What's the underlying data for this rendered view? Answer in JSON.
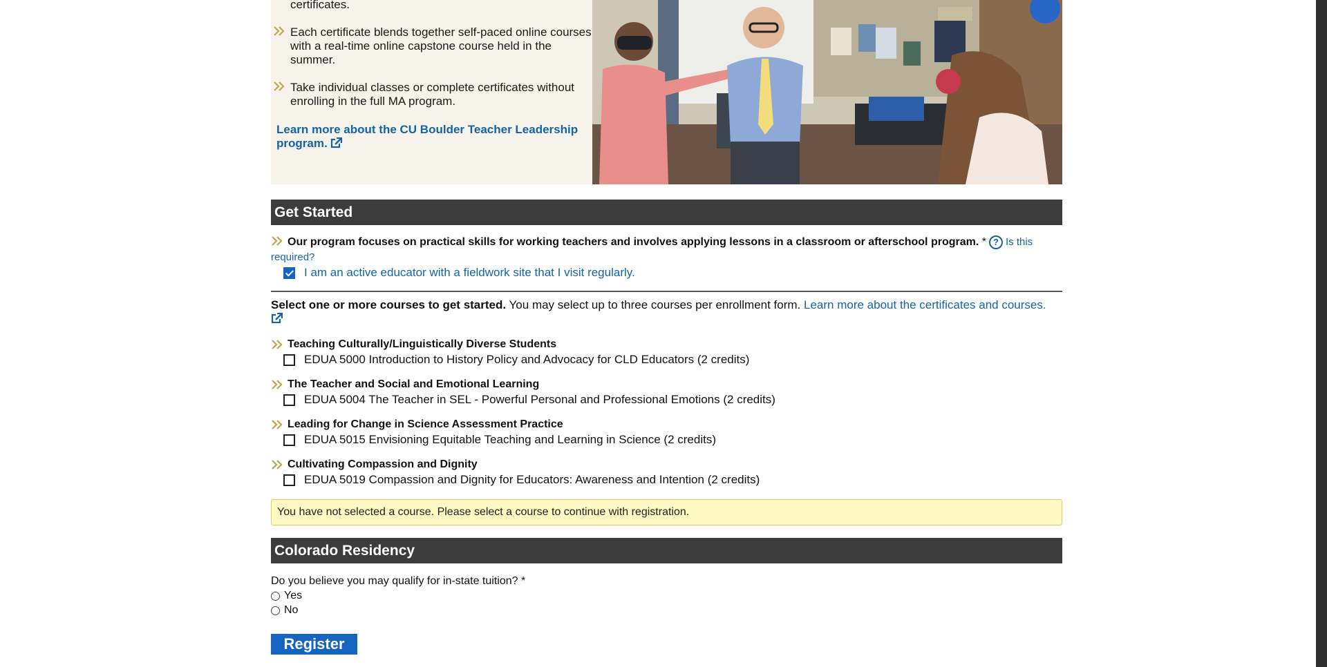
{
  "promo": {
    "bullet_partial": "certificates.",
    "bullet_1": "Each certificate blends together self-paced online courses with a real-time online capstone course held in the summer.",
    "bullet_2": "Take individual classes or complete certificates without enrolling in the full MA program.",
    "learn_more_link": "Learn more about the CU Boulder Teacher Leadership program."
  },
  "get_started": {
    "heading": "Get Started",
    "question": "Our program focuses on practical skills for working teachers and involves applying lessons in a classroom or afterschool program.",
    "required_mark": "*",
    "help_link": "Is this required?",
    "educator_checkbox_label": "I am an active educator with a fieldwork site that I visit regularly.",
    "educator_checked": true
  },
  "courses_section": {
    "intro_bold": "Select one or more courses to get started.",
    "intro_text": "You may select up to three courses per enrollment form.",
    "intro_link": "Learn more about the certificates and courses.",
    "groups": [
      {
        "title": "Teaching Culturally/Linguistically Diverse Students",
        "course": "EDUA 5000 Introduction to History Policy and Advocacy for CLD Educators (2 credits)",
        "checked": false
      },
      {
        "title": "The Teacher and Social and Emotional Learning",
        "course": "EDUA 5004 The Teacher in SEL - Powerful Personal and Professional Emotions (2 credits)",
        "checked": false
      },
      {
        "title": "Leading for Change in Science Assessment Practice",
        "course": "EDUA 5015 Envisioning Equitable Teaching and Learning in Science (2 credits)",
        "checked": false
      },
      {
        "title": "Cultivating Compassion and Dignity",
        "course": "EDUA 5019 Compassion and Dignity for Educators: Awareness and Intention (2 credits)",
        "checked": false
      }
    ],
    "alert": "You have not selected a course. Please select a course to continue with registration."
  },
  "residency": {
    "heading": "Colorado Residency",
    "question": "Do you believe you may qualify for in-state tuition? *",
    "options": [
      "Yes",
      "No"
    ]
  },
  "register_button": "Register",
  "colors": {
    "accent_blue": "#1464a5",
    "section_bar": "#3c3c3c",
    "chevron_gold": "#c9a34a",
    "alert_bg": "#fff9c4",
    "promo_bg": "#f6f3ea"
  },
  "icons": {
    "bullet": "double-chevron-right-icon",
    "help": "question-circle-icon",
    "external_link": "external-link-icon"
  }
}
